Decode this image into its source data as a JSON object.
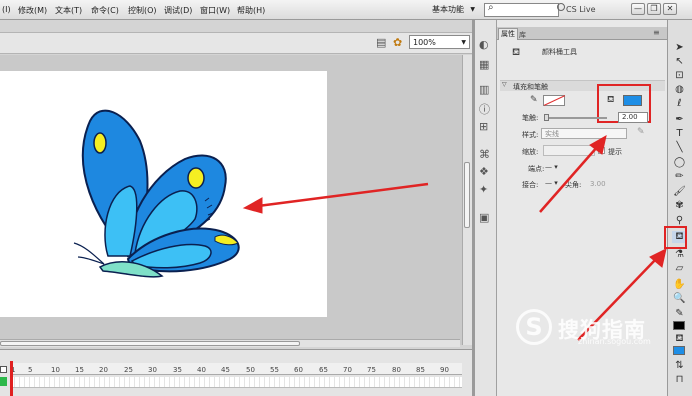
{
  "menubar": {
    "items": [
      "(I)",
      "修改(M)",
      "文本(T)",
      "命令(C)",
      "控制(O)",
      "调试(D)",
      "窗口(W)",
      "帮助(H)"
    ],
    "workspace": "基本功能",
    "cs_live": "CS Live",
    "min": "—",
    "restore": "❐",
    "close": "✕"
  },
  "editbar": {
    "zoom": "100%"
  },
  "timeline": {
    "frames": [
      "1",
      "5",
      "10",
      "15",
      "20",
      "25",
      "30",
      "35",
      "40",
      "45",
      "50",
      "55",
      "60",
      "65",
      "70",
      "75",
      "80",
      "85",
      "90"
    ]
  },
  "panel": {
    "tabs": {
      "properties": "属性",
      "library": "库"
    },
    "tool_name": "颜料桶工具",
    "section": "填充和笔触",
    "stroke_label": "笔触:",
    "stroke_value": "2.00",
    "style_label": "样式:",
    "style_value": "实线",
    "scale_label": "缩放:",
    "hint_label": "提示",
    "cap_label": "端点:",
    "join_label": "接合:",
    "miter_label": "尖角:",
    "miter_value": "3.00",
    "fill_color": "#1e8ee6"
  },
  "tools": {
    "stroke_color": "#000000",
    "fill_color": "#1e8ee6"
  },
  "watermark": {
    "text": "搜狗指南",
    "url": "zhinan.sogou.com"
  }
}
